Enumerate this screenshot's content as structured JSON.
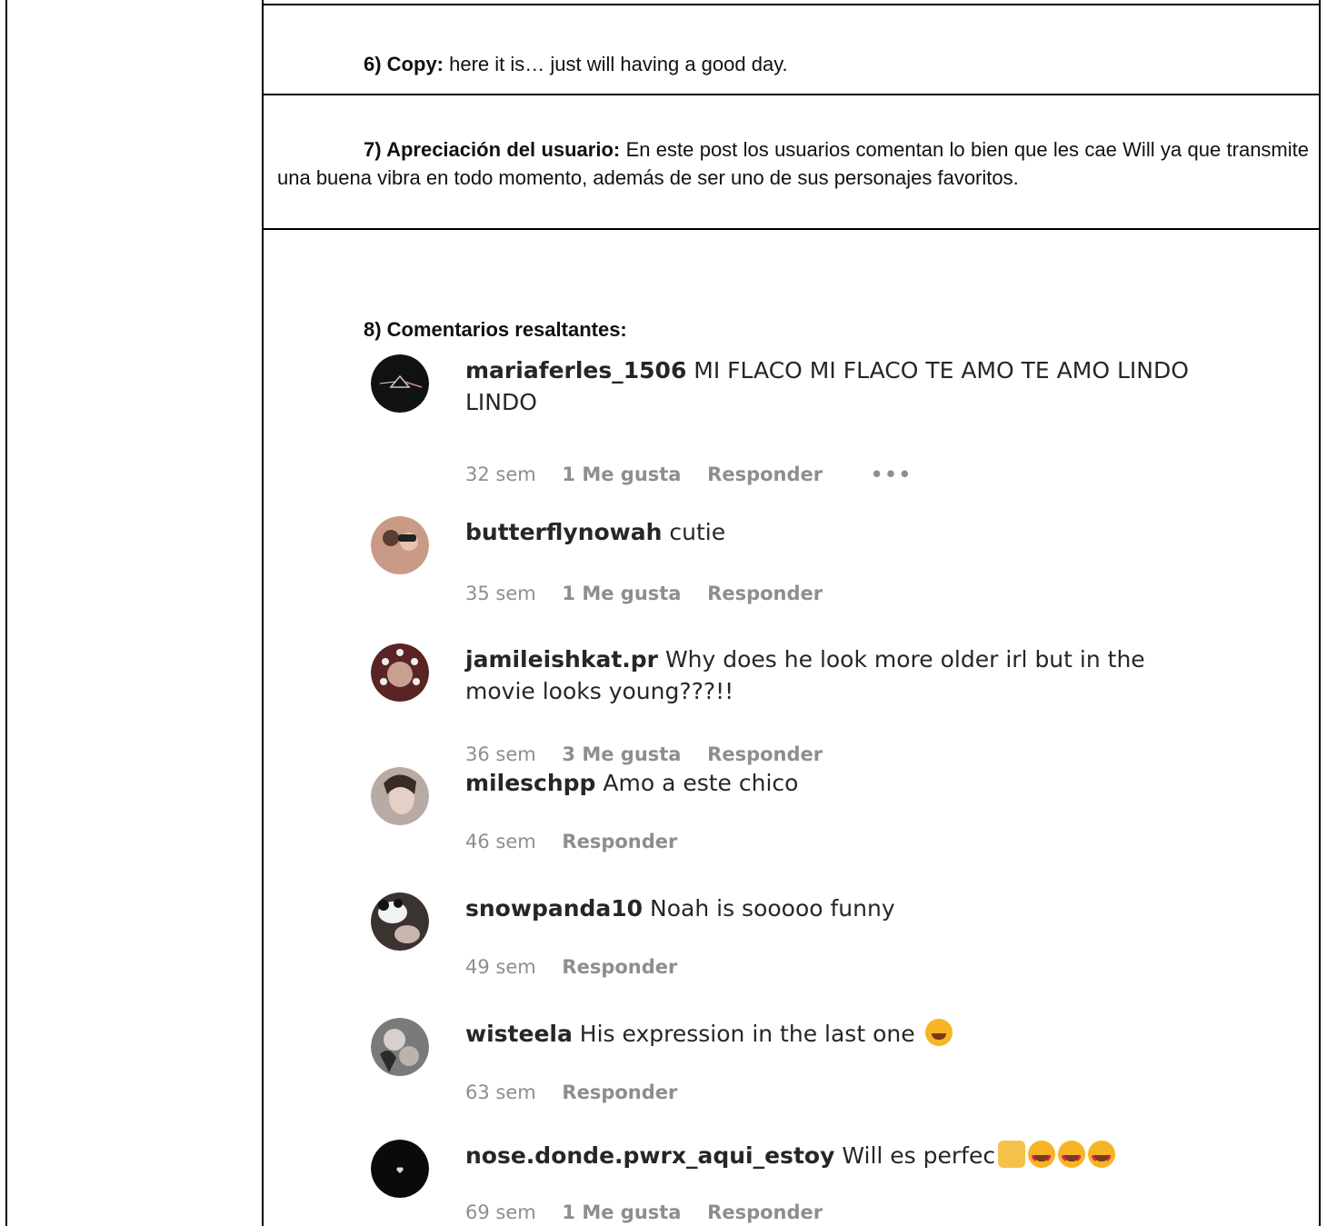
{
  "copy": {
    "label": "6) Copy:",
    "text": " here it is… just will having a good day."
  },
  "appreciation": {
    "label": "7) Apreciación del usuario:",
    "text": " En este post los usuarios comentan lo bien que les cae Will ya que transmite una buena vibra en todo momento, además de ser uno de sus personajes favoritos."
  },
  "comments_title": "8) Comentarios resaltantes:",
  "comments": [
    {
      "user": "mariaferles_1506",
      "text": " MI FLACO MI FLACO TE AMO TE AMO LINDO LINDO",
      "time": "32 sem",
      "likes": "1 Me gusta",
      "reply": "Responder",
      "more": "•••",
      "avatar_color": "#111111"
    },
    {
      "user": "butterflynowah",
      "text": " cutie",
      "time": "35 sem",
      "likes": "1 Me gusta",
      "reply": "Responder",
      "avatar_color": "#b07a6a"
    },
    {
      "user": "jamileishkat.pr",
      "text": " Why does he look more older irl but in the movie looks young???!!",
      "time": "36 sem",
      "likes": "3 Me gusta",
      "reply": "Responder",
      "avatar_color": "#6b2b2b"
    },
    {
      "user": "mileschpp",
      "text": " Amo a este chico",
      "time": "46 sem",
      "reply": "Responder",
      "avatar_color": "#9a8a84"
    },
    {
      "user": "snowpanda10",
      "text": " Noah is sooooo funny",
      "time": "49 sem",
      "reply": "Responder",
      "avatar_color": "#3a3330"
    },
    {
      "user": "wisteela",
      "text": " His expression in the last one ",
      "time": "63 sem",
      "reply": "Responder",
      "avatar_color": "#6f6f6f"
    },
    {
      "user": "nose.donde.pwrx_aqui_estoy",
      "text": " Will es perfec",
      "time": "69 sem",
      "likes": "1 Me gusta",
      "reply": "Responder",
      "avatar_color": "#0a0a0a"
    }
  ],
  "colors": {
    "text": "#262626",
    "meta": "#8e8e8e",
    "border": "#000000"
  }
}
